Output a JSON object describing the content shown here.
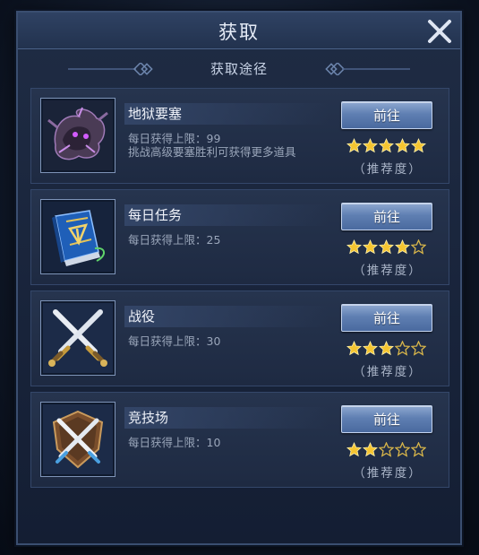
{
  "dialog": {
    "title": "获取",
    "section_title": "获取途径"
  },
  "sources": [
    {
      "name": "地狱要塞",
      "icon": "dragon-icon",
      "desc_lines": [
        "每日获得上限：99",
        "挑战高级要塞胜利可获得更多道具"
      ],
      "button": "前往",
      "stars": 5,
      "max_stars": 5,
      "recommend": "（推荐度）"
    },
    {
      "name": "每日任务",
      "icon": "quest-book-icon",
      "desc_lines": [
        "每日获得上限：25"
      ],
      "button": "前往",
      "stars": 4,
      "max_stars": 5,
      "recommend": "（推荐度）"
    },
    {
      "name": "战役",
      "icon": "crossed-swords-icon",
      "desc_lines": [
        "每日获得上限：30"
      ],
      "button": "前往",
      "stars": 3,
      "max_stars": 5,
      "recommend": "（推荐度）"
    },
    {
      "name": "竞技场",
      "icon": "shield-swords-icon",
      "desc_lines": [
        "每日获得上限：10"
      ],
      "button": "前往",
      "stars": 2,
      "max_stars": 5,
      "recommend": "（推荐度）"
    }
  ],
  "colors": {
    "star_filled": "#f5c531",
    "star_empty_outline": "#d8b64a",
    "button_top": "#8ea8d0",
    "button_bottom": "#4a6a9f"
  }
}
